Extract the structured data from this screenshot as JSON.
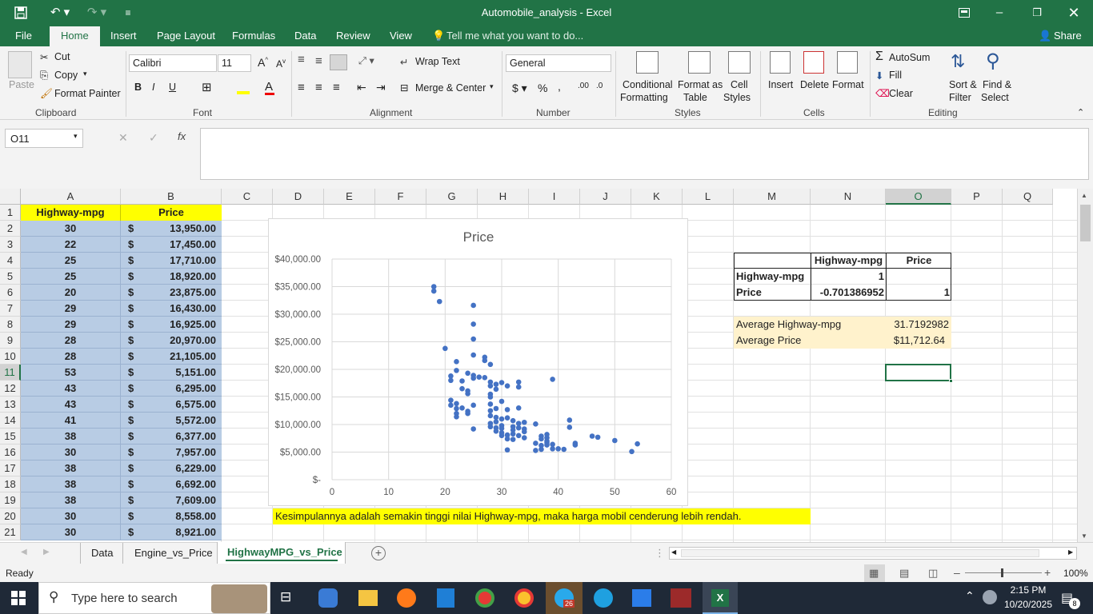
{
  "window": {
    "title": "Automobile_analysis - Excel"
  },
  "menu_tabs": [
    "File",
    "Home",
    "Insert",
    "Page Layout",
    "Formulas",
    "Data",
    "Review",
    "View"
  ],
  "tell_me": "Tell me what you want to do...",
  "share": "Share",
  "ribbon": {
    "clipboard": {
      "paste": "Paste",
      "cut": "Cut",
      "copy": "Copy",
      "format_painter": "Format Painter",
      "group": "Clipboard"
    },
    "font": {
      "name": "Calibri",
      "size": "11",
      "group": "Font"
    },
    "alignment": {
      "wrap": "Wrap Text",
      "merge": "Merge & Center",
      "group": "Alignment"
    },
    "number": {
      "format": "General",
      "group": "Number"
    },
    "styles": {
      "cond": "Conditional",
      "cond2": "Formatting",
      "fmt_table": "Format as",
      "fmt_table2": "Table",
      "cell_styles": "Cell",
      "cell_styles2": "Styles",
      "group": "Styles"
    },
    "cells": {
      "insert": "Insert",
      "delete": "Delete",
      "format": "Format",
      "group": "Cells"
    },
    "editing": {
      "autosum": "AutoSum",
      "fill": "Fill",
      "clear": "Clear",
      "sort": "Sort &",
      "sort2": "Filter",
      "find": "Find &",
      "find2": "Select",
      "group": "Editing"
    }
  },
  "name_box": "O11",
  "columns": [
    "A",
    "B",
    "C",
    "D",
    "E",
    "F",
    "G",
    "H",
    "I",
    "J",
    "K",
    "L",
    "M",
    "N",
    "O",
    "P",
    "Q"
  ],
  "rows": [
    "1",
    "2",
    "3",
    "4",
    "5",
    "6",
    "7",
    "8",
    "9",
    "10",
    "11",
    "12",
    "13",
    "14",
    "15",
    "16",
    "17",
    "18",
    "19",
    "20",
    "21"
  ],
  "headers": {
    "a1": "Highway-mpg",
    "b1": "Price"
  },
  "currency": "$",
  "data_rows": [
    {
      "mpg": "30",
      "price": "13,950.00"
    },
    {
      "mpg": "22",
      "price": "17,450.00"
    },
    {
      "mpg": "25",
      "price": "17,710.00"
    },
    {
      "mpg": "25",
      "price": "18,920.00"
    },
    {
      "mpg": "20",
      "price": "23,875.00"
    },
    {
      "mpg": "29",
      "price": "16,430.00"
    },
    {
      "mpg": "29",
      "price": "16,925.00"
    },
    {
      "mpg": "28",
      "price": "20,970.00"
    },
    {
      "mpg": "28",
      "price": "21,105.00"
    },
    {
      "mpg": "53",
      "price": "5,151.00"
    },
    {
      "mpg": "43",
      "price": "6,295.00"
    },
    {
      "mpg": "43",
      "price": "6,575.00"
    },
    {
      "mpg": "41",
      "price": "5,572.00"
    },
    {
      "mpg": "38",
      "price": "6,377.00"
    },
    {
      "mpg": "30",
      "price": "7,957.00"
    },
    {
      "mpg": "38",
      "price": "6,229.00"
    },
    {
      "mpg": "38",
      "price": "6,692.00"
    },
    {
      "mpg": "38",
      "price": "7,609.00"
    },
    {
      "mpg": "30",
      "price": "8,558.00"
    },
    {
      "mpg": "30",
      "price": "8,921.00"
    }
  ],
  "correlation": {
    "col_h1": "Highway-mpg",
    "col_h2": "Price",
    "r1_label": "Highway-mpg",
    "r1_v1": "1",
    "r2_label": "Price",
    "r2_v1": "-0.701386952",
    "r2_v2": "1"
  },
  "averages": {
    "mpg_label": "Average Highway-mpg",
    "mpg_value": "31.7192982",
    "price_label": "Average Price",
    "price_value": "$11,712.64"
  },
  "conclusion": "Kesimpulannya adalah semakin tinggi nilai Highway-mpg, maka harga mobil cenderung lebih rendah.",
  "chart_data": {
    "type": "scatter",
    "title": "Price",
    "xlim": [
      0,
      60
    ],
    "ylim": [
      0,
      40000
    ],
    "x_ticks": [
      "0",
      "10",
      "20",
      "30",
      "40",
      "50",
      "60"
    ],
    "y_ticks": [
      "$-",
      "$5,000.00",
      "$10,000.00",
      "$15,000.00",
      "$20,000.00",
      "$25,000.00",
      "$30,000.00",
      "$35,000.00",
      "$40,000.00"
    ],
    "grid": true,
    "color": "#4472c4",
    "points": [
      [
        18,
        35000
      ],
      [
        18,
        34200
      ],
      [
        19,
        32300
      ],
      [
        20,
        23800
      ],
      [
        25,
        31600
      ],
      [
        25,
        28200
      ],
      [
        25,
        25500
      ],
      [
        25,
        22600
      ],
      [
        27,
        22200
      ],
      [
        27,
        21600
      ],
      [
        28,
        20900
      ],
      [
        22,
        21400
      ],
      [
        22,
        19800
      ],
      [
        24,
        19300
      ],
      [
        25,
        18900
      ],
      [
        25,
        18400
      ],
      [
        26,
        18600
      ],
      [
        27,
        18500
      ],
      [
        28,
        17700
      ],
      [
        28,
        17000
      ],
      [
        29,
        17300
      ],
      [
        29,
        16400
      ],
      [
        30,
        17600
      ],
      [
        31,
        17000
      ],
      [
        33,
        17700
      ],
      [
        33,
        16800
      ],
      [
        39,
        18200
      ],
      [
        21,
        18800
      ],
      [
        21,
        18000
      ],
      [
        23,
        17900
      ],
      [
        23,
        16500
      ],
      [
        24,
        16100
      ],
      [
        24,
        15600
      ],
      [
        28,
        15500
      ],
      [
        28,
        15000
      ],
      [
        30,
        14200
      ],
      [
        21,
        14400
      ],
      [
        21,
        13500
      ],
      [
        22,
        13800
      ],
      [
        22,
        12900
      ],
      [
        23,
        13000
      ],
      [
        24,
        12400
      ],
      [
        25,
        13500
      ],
      [
        28,
        13700
      ],
      [
        29,
        12900
      ],
      [
        31,
        12700
      ],
      [
        33,
        13000
      ],
      [
        22,
        12000
      ],
      [
        22,
        11400
      ],
      [
        24,
        12000
      ],
      [
        28,
        11600
      ],
      [
        29,
        11300
      ],
      [
        30,
        11000
      ],
      [
        31,
        11200
      ],
      [
        32,
        10700
      ],
      [
        34,
        10400
      ],
      [
        36,
        10100
      ],
      [
        42,
        10800
      ],
      [
        28,
        10200
      ],
      [
        28,
        9600
      ],
      [
        29,
        9400
      ],
      [
        30,
        9800
      ],
      [
        30,
        9300
      ],
      [
        32,
        9600
      ],
      [
        32,
        9000
      ],
      [
        33,
        9400
      ],
      [
        34,
        9200
      ],
      [
        34,
        8700
      ],
      [
        33,
        10200
      ],
      [
        25,
        9200
      ],
      [
        29,
        8800
      ],
      [
        30,
        8500
      ],
      [
        30,
        8000
      ],
      [
        31,
        8100
      ],
      [
        32,
        8300
      ],
      [
        33,
        8000
      ],
      [
        31,
        7400
      ],
      [
        32,
        7300
      ],
      [
        34,
        7600
      ],
      [
        37,
        7900
      ],
      [
        38,
        8200
      ],
      [
        38,
        7600
      ],
      [
        38,
        7000
      ],
      [
        37,
        7400
      ],
      [
        38,
        6700
      ],
      [
        39,
        6400
      ],
      [
        36,
        6600
      ],
      [
        37,
        6200
      ],
      [
        38,
        6300
      ],
      [
        43,
        6300
      ],
      [
        43,
        6600
      ],
      [
        46,
        7900
      ],
      [
        47,
        7700
      ],
      [
        50,
        7100
      ],
      [
        54,
        6500
      ],
      [
        36,
        5300
      ],
      [
        37,
        5500
      ],
      [
        40,
        5600
      ],
      [
        41,
        5500
      ],
      [
        39,
        5600
      ],
      [
        31,
        5400
      ],
      [
        53,
        5100
      ],
      [
        42,
        9500
      ],
      [
        28,
        12500
      ],
      [
        29,
        10500
      ]
    ]
  },
  "sheet_tabs": [
    "Data",
    "Engine_vs_Price",
    "HighwayMPG_vs_Price"
  ],
  "status": {
    "ready": "Ready",
    "zoom": "100%"
  },
  "taskbar": {
    "search": "Type here to search",
    "time": "2:15 PM",
    "date": "10/20/2025",
    "notif": "8",
    "badge": "26"
  }
}
